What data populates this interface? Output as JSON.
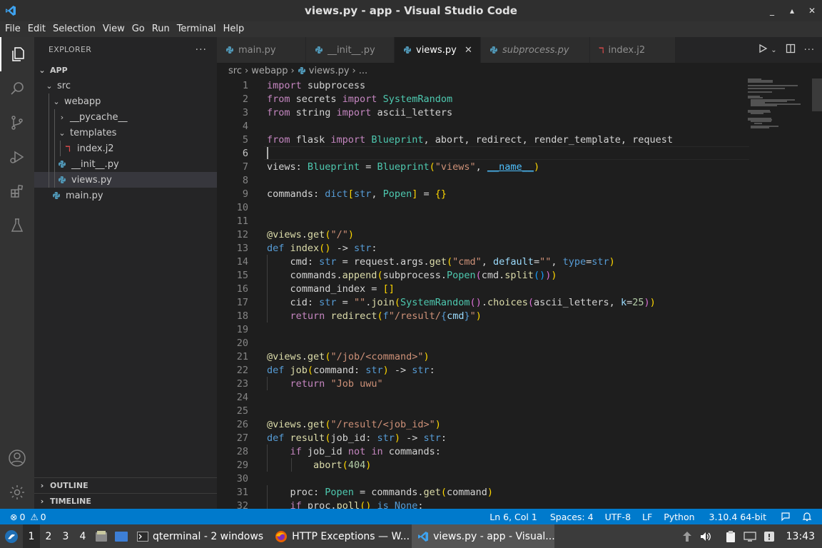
{
  "window": {
    "title": "views.py - app - Visual Studio Code",
    "controls": [
      "_",
      "▴",
      "✕"
    ]
  },
  "menu": [
    "File",
    "Edit",
    "Selection",
    "View",
    "Go",
    "Run",
    "Terminal",
    "Help"
  ],
  "sidebar": {
    "header": "EXPLORER",
    "more": "···",
    "root": "APP",
    "tree": [
      {
        "label": "src",
        "type": "folder"
      },
      {
        "label": "webapp",
        "type": "folder"
      },
      {
        "label": "__pycache__",
        "type": "folder"
      },
      {
        "label": "templates",
        "type": "folder"
      },
      {
        "label": "index.j2",
        "type": "file"
      },
      {
        "label": "__init__.py",
        "type": "file"
      },
      {
        "label": "views.py",
        "type": "file"
      },
      {
        "label": "main.py",
        "type": "file"
      }
    ],
    "sections": [
      "OUTLINE",
      "TIMELINE"
    ]
  },
  "tabs": [
    {
      "label": "main.py"
    },
    {
      "label": "__init__.py"
    },
    {
      "label": "views.py",
      "close": "✕"
    },
    {
      "label": "subprocess.py"
    },
    {
      "label": "index.j2"
    }
  ],
  "breadcrumb": [
    "src",
    "webapp",
    "views.py",
    "..."
  ],
  "line_numbers": [
    "1",
    "2",
    "3",
    "4",
    "5",
    "6",
    "7",
    "8",
    "9",
    "10",
    "11",
    "12",
    "13",
    "14",
    "15",
    "16",
    "17",
    "18",
    "19",
    "20",
    "21",
    "22",
    "23",
    "24",
    "25",
    "26",
    "27",
    "28",
    "29",
    "30",
    "31",
    "32"
  ],
  "code_lines": [
    "import subprocess",
    "from secrets import SystemRandom",
    "from string import ascii_letters",
    "",
    "from flask import Blueprint, abort, redirect, render_template, request",
    "",
    "views: Blueprint = Blueprint(\"views\", __name__)",
    "",
    "commands: dict[str, Popen] = {}",
    "",
    "",
    "@views.get(\"/\")",
    "def index() -> str:",
    "    cmd: str = request.args.get(\"cmd\", default=\"\", type=str)",
    "    commands.append(subprocess.Popen(cmd.split()))",
    "    command_index = []",
    "    cid: str = \"\".join(SystemRandom().choices(ascii_letters, k=25))",
    "    return redirect(f\"/result/{cmd}\")",
    "",
    "",
    "@views.get(\"/job/<command>\")",
    "def job(command: str) -> str:",
    "    return \"Job uwu\"",
    "",
    "",
    "@views.get(\"/result/<job_id>\")",
    "def result(job_id: str) -> str:",
    "    if job_id not in commands:",
    "        abort(404)",
    "",
    "    proc: Popen = commands.get(command)",
    "    if proc.poll() is None:"
  ],
  "status": {
    "errors": "0",
    "warnings": "0",
    "position": "Ln 6, Col 1",
    "spaces": "Spaces: 4",
    "encoding": "UTF-8",
    "eol": "LF",
    "language": "Python",
    "interpreter": "3.10.4 64-bit"
  },
  "taskbar": {
    "workspaces": [
      "1",
      "2",
      "3",
      "4"
    ],
    "tasks": [
      {
        "label": "qterminal - 2 windows"
      },
      {
        "label": "HTTP Exceptions — W..."
      },
      {
        "label": "views.py - app - Visual..."
      }
    ],
    "clock": "13:43"
  },
  "colors": {
    "accent": "#007acc",
    "keyword": "#c586c0",
    "builtin": "#569cd6",
    "function": "#dcdcaa",
    "type": "#4ec9b0",
    "string": "#ce9178",
    "number": "#b5cea8"
  }
}
